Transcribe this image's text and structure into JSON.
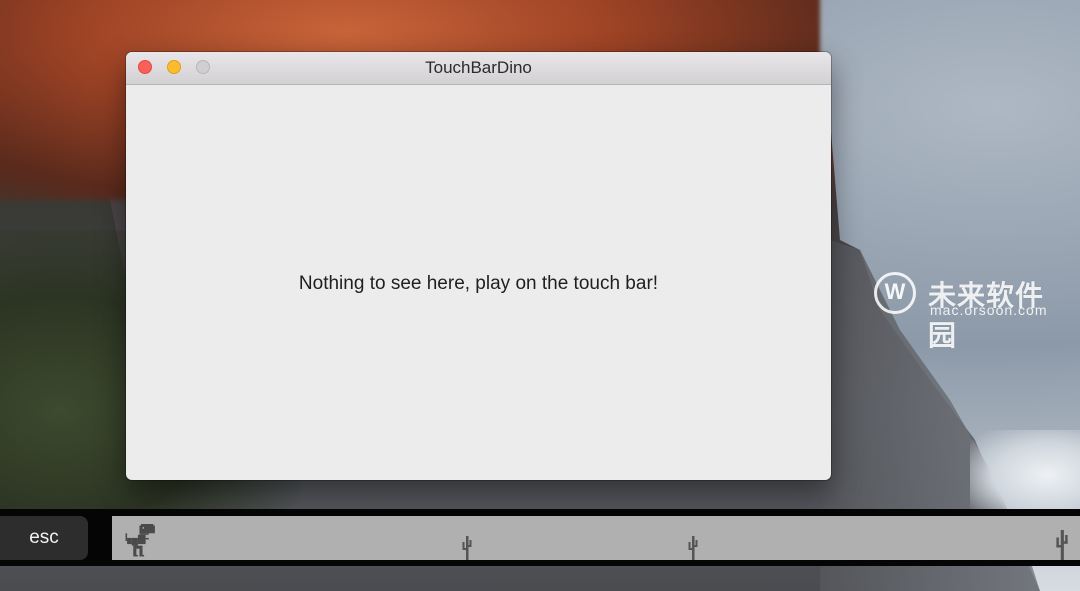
{
  "window": {
    "title": "TouchBarDino",
    "message": "Nothing to see here, play on the touch bar!"
  },
  "touchbar": {
    "esc_label": "esc"
  },
  "watermark": {
    "name": "未来软件园",
    "url": "mac.orsoon.com"
  },
  "colors": {
    "close": "#fc5f57",
    "minimize": "#fdbc2e",
    "zoom_disabled": "#d0ced0",
    "window_bg": "#ececec",
    "touchbar_bg": "#050505",
    "game_bg": "#b0b0b0"
  },
  "icons": [
    "close-icon",
    "minimize-icon",
    "zoom-icon",
    "dino-icon",
    "cactus-icon"
  ]
}
